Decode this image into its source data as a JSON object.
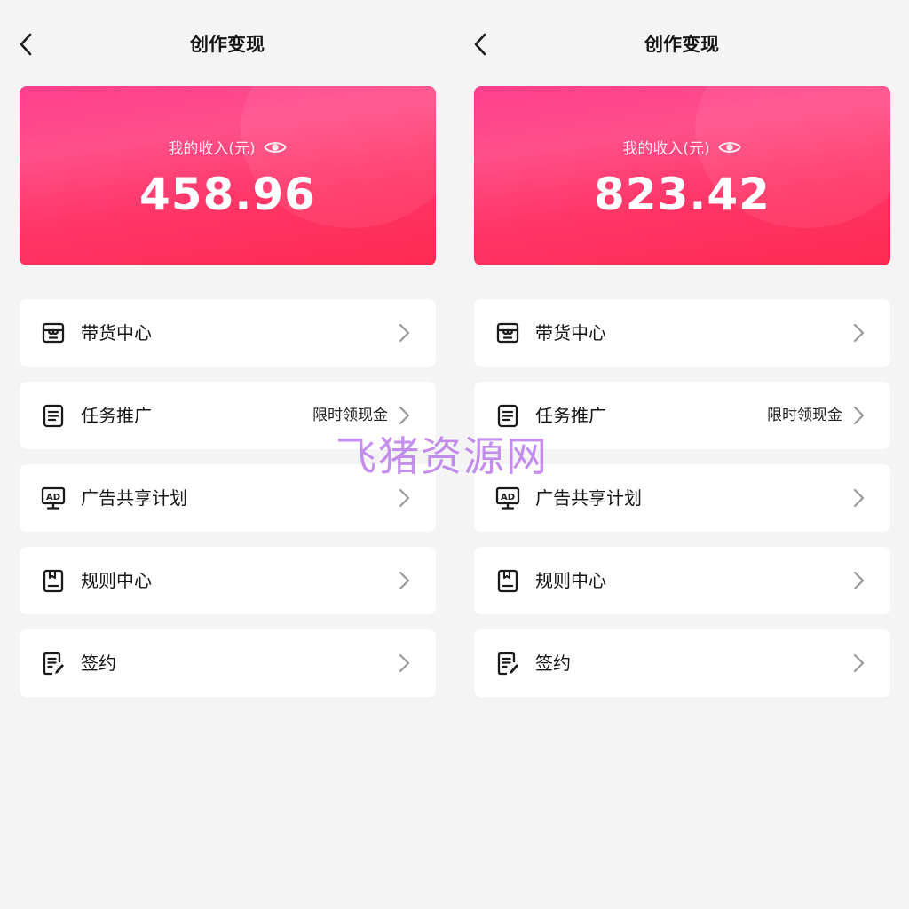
{
  "colors": {
    "page_bg": "#f4f4f4",
    "card_gradient_top": "#ff3f8c",
    "card_gradient_bottom": "#ff2a52",
    "text_primary": "#161616",
    "chevron": "#9a9a9a"
  },
  "watermark": "飞猪资源网",
  "screens": [
    {
      "header": {
        "back_icon": "chevron-left-icon",
        "title": "创作变现"
      },
      "income": {
        "label": "我的收入(元)",
        "eye_icon": "eye-icon",
        "amount": "458.96"
      },
      "menu": [
        {
          "icon": "store-icon",
          "label": "带货中心",
          "extra": ""
        },
        {
          "icon": "document-icon",
          "label": "任务推广",
          "extra": "限时领现金"
        },
        {
          "icon": "ad-monitor-icon",
          "label": "广告共享计划",
          "extra": ""
        },
        {
          "icon": "rulebook-icon",
          "label": "规则中心",
          "extra": ""
        },
        {
          "icon": "sign-document-icon",
          "label": "签约",
          "extra": ""
        }
      ]
    },
    {
      "header": {
        "back_icon": "chevron-left-icon",
        "title": "创作变现"
      },
      "income": {
        "label": "我的收入(元)",
        "eye_icon": "eye-icon",
        "amount": "823.42"
      },
      "menu": [
        {
          "icon": "store-icon",
          "label": "带货中心",
          "extra": ""
        },
        {
          "icon": "document-icon",
          "label": "任务推广",
          "extra": "限时领现金"
        },
        {
          "icon": "ad-monitor-icon",
          "label": "广告共享计划",
          "extra": ""
        },
        {
          "icon": "rulebook-icon",
          "label": "规则中心",
          "extra": ""
        },
        {
          "icon": "sign-document-icon",
          "label": "签约",
          "extra": ""
        }
      ]
    }
  ]
}
